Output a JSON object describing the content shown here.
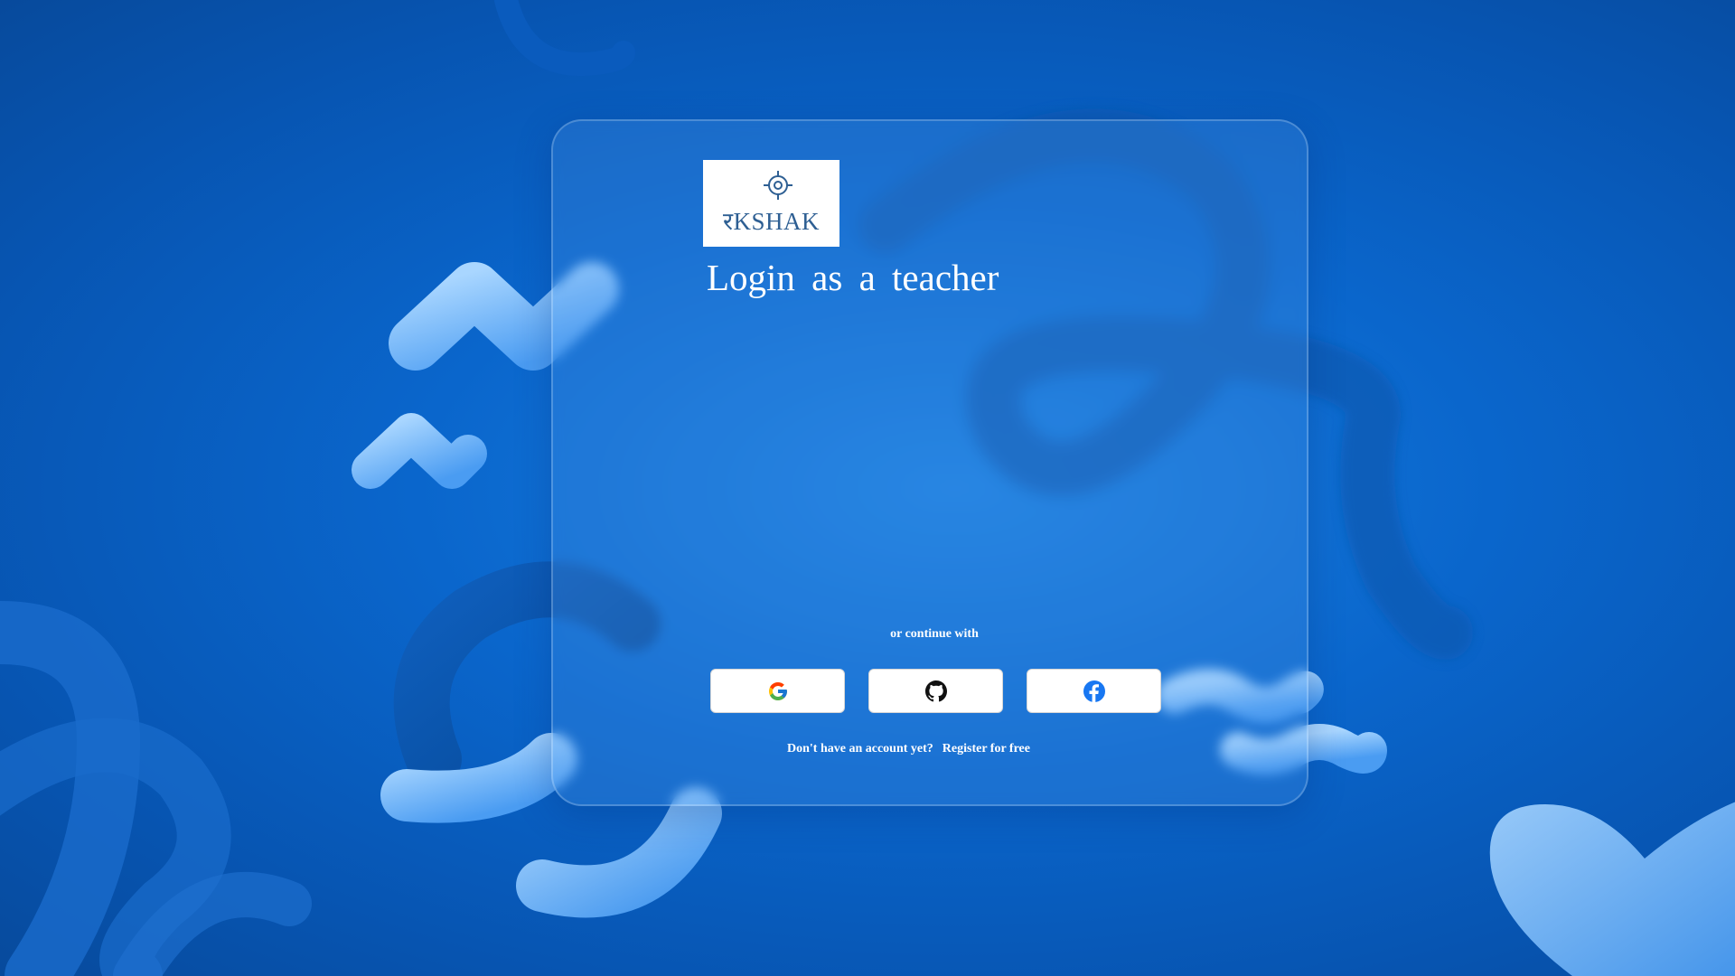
{
  "colors": {
    "background": "#0a66cc",
    "card": "#5aa0eb",
    "logo_text": "#2e5f93",
    "shape_light": "#6fb8ff"
  },
  "logo": {
    "text": "रKSHAK",
    "icon": "crosshair-icon"
  },
  "login": {
    "title": "Login as a teacher",
    "continue_text": "or continue with"
  },
  "social": [
    {
      "provider": "Google",
      "icon": "google-icon"
    },
    {
      "provider": "GitHub",
      "icon": "github-icon"
    },
    {
      "provider": "Facebook",
      "icon": "facebook-icon"
    }
  ],
  "footer": {
    "prompt": "Don't have an account yet?",
    "link": "Register for free"
  }
}
